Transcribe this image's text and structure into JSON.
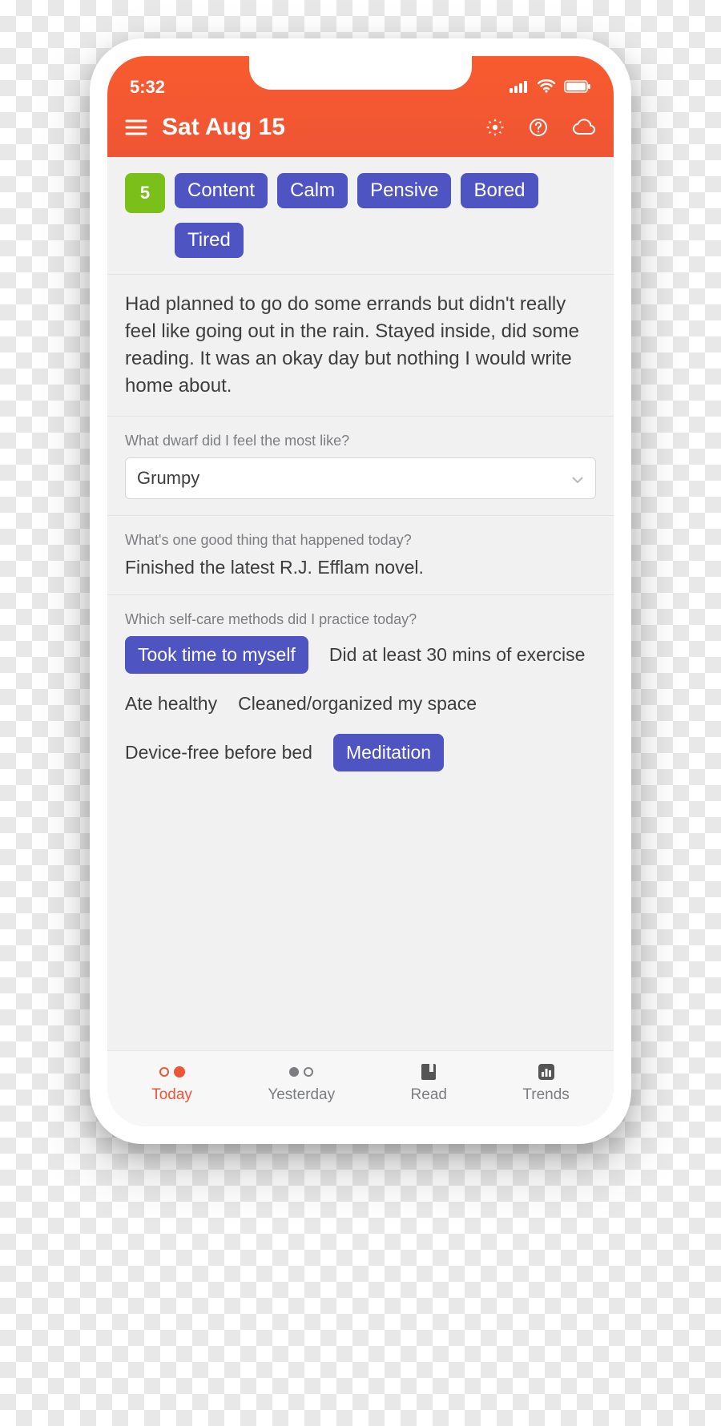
{
  "status": {
    "time": "5:32"
  },
  "header": {
    "date_title": "Sat Aug 15"
  },
  "score": "5",
  "mood_tags": [
    "Content",
    "Calm",
    "Pensive",
    "Bored",
    "Tired"
  ],
  "journal_text": "Had planned to go do some errands but didn't really feel like going out in the rain. Stayed inside, did some reading. It was an okay day but nothing I would write home about.",
  "q_dwarf": {
    "label": "What dwarf did I feel the most like?",
    "value": "Grumpy"
  },
  "q_good": {
    "label": "What's one good thing that happened today?",
    "answer": "Finished the latest R.J. Efflam novel."
  },
  "q_selfcare": {
    "label": "Which self-care methods did I practice today?",
    "options": [
      {
        "text": "Took time to myself",
        "on": true
      },
      {
        "text": "Did at least 30 mins of exercise",
        "on": false
      },
      {
        "text": "Ate healthy",
        "on": false
      },
      {
        "text": "Cleaned/organized my space",
        "on": false
      },
      {
        "text": "Device-free before bed",
        "on": false
      },
      {
        "text": "Meditation",
        "on": true
      }
    ]
  },
  "nav": {
    "items": [
      {
        "key": "today",
        "label": "Today"
      },
      {
        "key": "yesterday",
        "label": "Yesterday"
      },
      {
        "key": "read",
        "label": "Read"
      },
      {
        "key": "trends",
        "label": "Trends"
      }
    ]
  }
}
